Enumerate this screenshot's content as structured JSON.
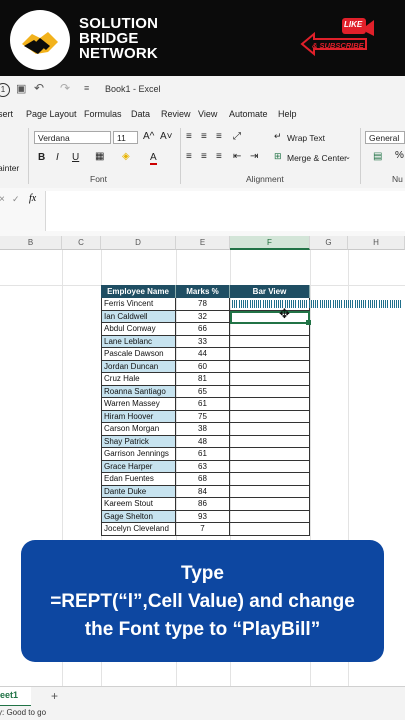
{
  "banner": {
    "brand_line1": "SOLUTION",
    "brand_line2": "BRIDGE",
    "brand_line3": "NETWORK",
    "badge_line1": "LIKE",
    "badge_line2": "& SUBSCRIBE",
    "logo_icon": "handshake-icon"
  },
  "titlebar": {
    "undo_num": "1",
    "book_title": "Book1  -  Excel"
  },
  "ribbon_tabs": [
    "sert",
    "Page Layout",
    "Formulas",
    "Data",
    "Review",
    "View",
    "Automate",
    "Help"
  ],
  "ribbon": {
    "font_name": "Verdana",
    "font_size": "11",
    "grow_font": "A^",
    "shrink_font": "A˅",
    "bold": "B",
    "italic": "I",
    "underline": "U",
    "font_color": "A",
    "wrap_text": "Wrap Text",
    "merge_center": "Merge & Center",
    "number_format": "General",
    "percent": "%",
    "painter": "ainter",
    "font_group": "Font",
    "alignment_group": "Alignment",
    "number_group": "Nu"
  },
  "formula": {
    "fx": "fx",
    "cancel": "×",
    "enter": "✓"
  },
  "columns": [
    "B",
    "C",
    "D",
    "E",
    "F",
    "G",
    "H"
  ],
  "table": {
    "headers": {
      "name": "Employee Name",
      "marks": "Marks %",
      "bar": "Bar View"
    },
    "rows": [
      {
        "name": "Ferris Vincent",
        "marks": "78"
      },
      {
        "name": "Ian Caldwell",
        "marks": "32"
      },
      {
        "name": "Abdul Conway",
        "marks": "66"
      },
      {
        "name": "Lane Leblanc",
        "marks": "33"
      },
      {
        "name": "Pascale Dawson",
        "marks": "44"
      },
      {
        "name": "Jordan Duncan",
        "marks": "60"
      },
      {
        "name": "Cruz Hale",
        "marks": "81"
      },
      {
        "name": "Roanna Santiago",
        "marks": "65"
      },
      {
        "name": "Warren Massey",
        "marks": "61"
      },
      {
        "name": "Hiram Hoover",
        "marks": "75"
      },
      {
        "name": "Carson Morgan",
        "marks": "38"
      },
      {
        "name": "Shay Patrick",
        "marks": "48"
      },
      {
        "name": "Garrison Jennings",
        "marks": "61"
      },
      {
        "name": "Grace Harper",
        "marks": "63"
      },
      {
        "name": "Edan Fuentes",
        "marks": "68"
      },
      {
        "name": "Dante Duke",
        "marks": "84"
      },
      {
        "name": "Kareem Stout",
        "marks": "86"
      },
      {
        "name": "Gage Shelton",
        "marks": "93"
      },
      {
        "name": "Jocelyn Cleveland",
        "marks": "7"
      }
    ]
  },
  "callout": {
    "line1": "Type",
    "line2": "=REPT(“l”,Cell Value) and change",
    "line3": "the Font type to “PlayBill”"
  },
  "sheet_tab": "eet1",
  "add_sheet": "+",
  "status": "y: Good to go",
  "colors": {
    "header_bg": "#1f4e63",
    "highlight": "#c7e3ef",
    "callout": "#0d47a1",
    "excel_green": "#217346"
  }
}
